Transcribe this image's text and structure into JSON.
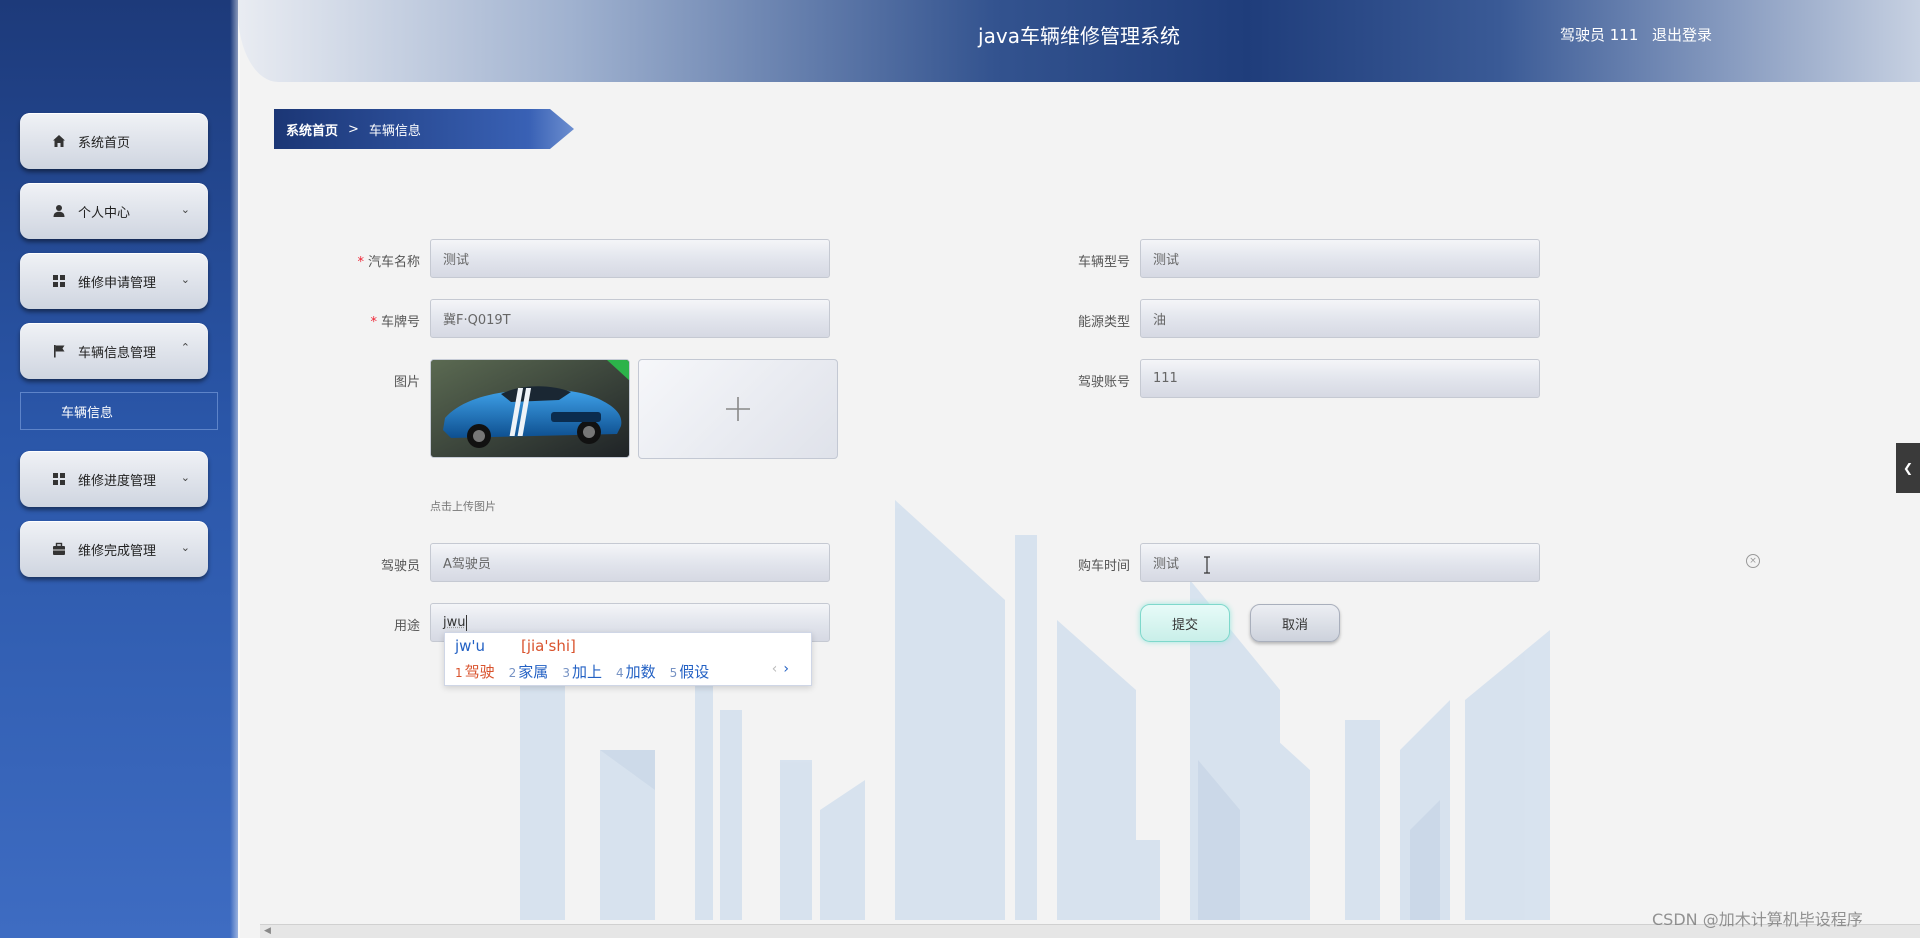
{
  "app": {
    "title": "java车辆维修管理系统",
    "user": "驾驶员 111",
    "logout": "退出登录"
  },
  "sidebar": {
    "items": [
      {
        "label": "系统首页",
        "icon": "home-icon"
      },
      {
        "label": "个人中心",
        "icon": "user-icon"
      },
      {
        "label": "维修申请管理",
        "icon": "grid-icon"
      },
      {
        "label": "车辆信息管理",
        "icon": "flag-icon"
      },
      {
        "label": "维修进度管理",
        "icon": "grid-icon"
      },
      {
        "label": "维修完成管理",
        "icon": "briefcase-icon"
      }
    ],
    "submenu_active": "车辆信息"
  },
  "breadcrumb": {
    "home": "系统首页",
    "separator": ">",
    "current": "车辆信息"
  },
  "form": {
    "car_name_label": "汽车名称",
    "car_name_value": "测试",
    "car_model_label": "车辆型号",
    "car_model_value": "测试",
    "plate_label": "车牌号",
    "plate_value": "冀F·Q019T",
    "energy_label": "能源类型",
    "energy_value": "油",
    "image_label": "图片",
    "upload_tip": "点击上传图片",
    "driver_account_label": "驾驶账号",
    "driver_account_value": "111",
    "driver_label": "驾驶员",
    "driver_value": "A驾驶员",
    "purchase_time_label": "购车时间",
    "purchase_time_value": "测试",
    "usage_label": "用途",
    "usage_value": "jwu",
    "required_mark": "*",
    "submit": "提交",
    "cancel": "取消"
  },
  "ime": {
    "composition": "jw'u",
    "pinyin": "[jia'shi]",
    "candidates": [
      {
        "n": "1",
        "text": "驾驶"
      },
      {
        "n": "2",
        "text": "家属"
      },
      {
        "n": "3",
        "text": "加上"
      },
      {
        "n": "4",
        "text": "加数"
      },
      {
        "n": "5",
        "text": "假设"
      }
    ],
    "prev": "‹",
    "next": "›"
  },
  "watermark": "CSDN @加木计算机毕设程序",
  "colors": {
    "sidebar": "#2a56a8",
    "header_dark": "#1f3d7b",
    "required": "#ee2233",
    "ime_highlight": "#d9532d"
  }
}
